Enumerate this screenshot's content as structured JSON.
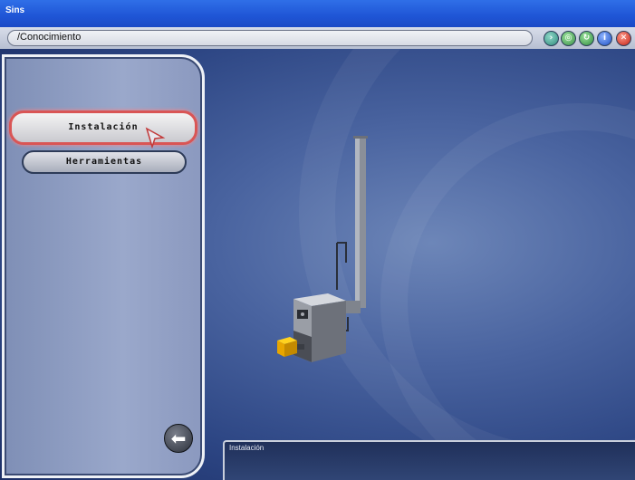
{
  "window": {
    "title": "Sins"
  },
  "pathbar": {
    "path": "/Conocimiento",
    "buttons": [
      {
        "icon": "forward-icon",
        "color": "#3f9a8c"
      },
      {
        "icon": "globe-icon",
        "color": "#4ba35f"
      },
      {
        "icon": "refresh-icon",
        "color": "#3a9a4a"
      },
      {
        "icon": "info-icon",
        "color": "#2d5fd0"
      },
      {
        "icon": "close-icon",
        "color": "#cc2b1f"
      }
    ]
  },
  "sidebar": {
    "items": [
      {
        "label": "Instalación",
        "active": true
      },
      {
        "label": "Herramientas",
        "active": false
      }
    ],
    "back_icon": "back-arrow-icon"
  },
  "info_panel": {
    "title": "Instalación"
  }
}
